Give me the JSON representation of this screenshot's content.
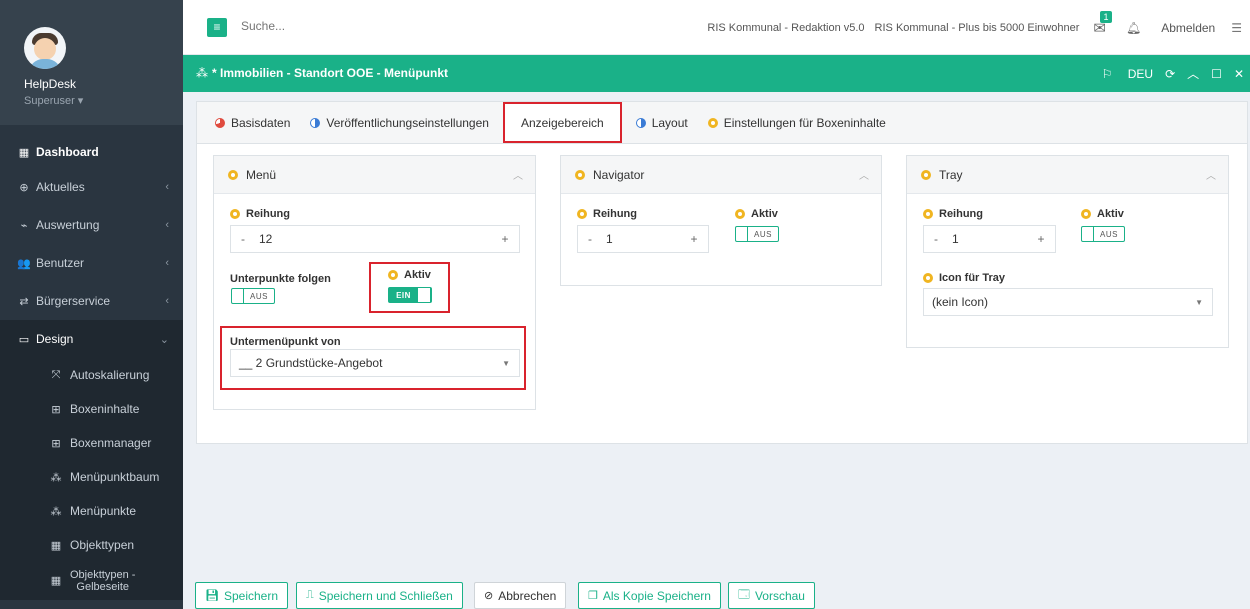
{
  "sidebar": {
    "user_name": "HelpDesk",
    "user_role": "Superuser ▾",
    "items": [
      {
        "label": "Dashboard",
        "icon": "▦"
      },
      {
        "label": "Aktuelles",
        "icon": "⊕"
      },
      {
        "label": "Auswertung",
        "icon": "⌁"
      },
      {
        "label": "Benutzer",
        "icon": "👥"
      },
      {
        "label": "Bürgerservice",
        "icon": "⇄"
      },
      {
        "label": "Design",
        "icon": "▭"
      }
    ],
    "sub_items": [
      {
        "label": "Autoskalierung",
        "icon": "⤧"
      },
      {
        "label": "Boxeninhalte",
        "icon": "⊞"
      },
      {
        "label": "Boxenmanager",
        "icon": "⊞"
      },
      {
        "label": "Menüpunktbaum",
        "icon": "⁂"
      },
      {
        "label": "Menüpunkte",
        "icon": "⁂"
      },
      {
        "label": "Objekttypen",
        "icon": "▦"
      },
      {
        "label": "Objekttypen -\nGelbeseite",
        "icon": "▦"
      }
    ]
  },
  "topbar": {
    "search_placeholder": "Suche...",
    "product": "RIS Kommunal - Redaktion v5.0",
    "license": "RIS Kommunal - Plus bis 5000 Einwohner",
    "mail_badge": "1",
    "logout": "Abmelden"
  },
  "titlebar": {
    "title": "* Immobilien - Standort OOE - Menüpunkt",
    "lang": "DEU"
  },
  "tabs": [
    {
      "label": "Basisdaten"
    },
    {
      "label": "Veröffentlichungseinstellungen"
    },
    {
      "label": "Anzeigebereich"
    },
    {
      "label": "Layout"
    },
    {
      "label": "Einstellungen für Boxeninhalte"
    }
  ],
  "menu_card": {
    "title": "Menü",
    "order_label": "Reihung",
    "order_value": "12",
    "follow_label": "Unterpunkte folgen",
    "follow_toggle": "AUS",
    "active_label": "Aktiv",
    "active_toggle": "EIN",
    "parent_label": "Untermenüpunkt von",
    "parent_value": "__ 2 Grundstücke-Angebot"
  },
  "navigator_card": {
    "title": "Navigator",
    "order_label": "Reihung",
    "order_value": "1",
    "active_label": "Aktiv",
    "active_toggle": "AUS"
  },
  "tray_card": {
    "title": "Tray",
    "order_label": "Reihung",
    "order_value": "1",
    "active_label": "Aktiv",
    "active_toggle": "AUS",
    "icon_label": "Icon für Tray",
    "icon_value": "(kein Icon)"
  },
  "footer": {
    "save": "Speichern",
    "save_close": "Speichern und Schließen",
    "cancel": "Abbrechen",
    "save_copy": "Als Kopie Speichern",
    "preview": "Vorschau"
  },
  "colors": {
    "accent": "#1ab188",
    "sidebar": "#2a3540",
    "highlight": "#d9232d",
    "status_dot": "#f0b521"
  }
}
